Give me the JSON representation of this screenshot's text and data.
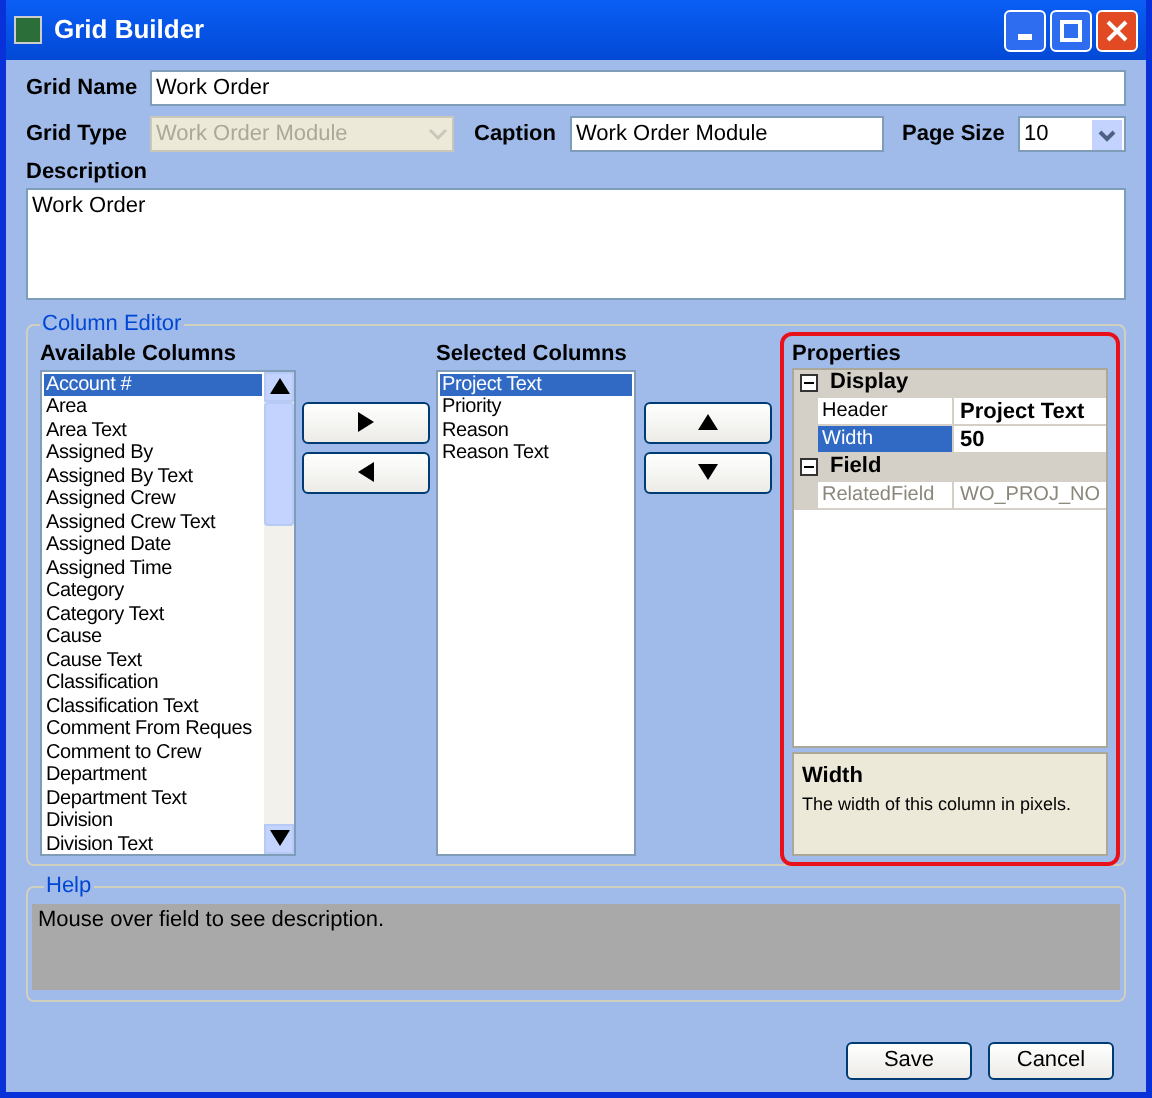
{
  "window": {
    "title": "Grid Builder"
  },
  "grid_name": {
    "label": "Grid Name",
    "value": "Work Order"
  },
  "grid_type": {
    "label": "Grid Type",
    "value": "Work Order Module",
    "disabled": true
  },
  "caption": {
    "label": "Caption",
    "value": "Work Order Module"
  },
  "page_size": {
    "label": "Page Size",
    "value": "10"
  },
  "description": {
    "label": "Description",
    "value": "Work Order"
  },
  "column_editor": {
    "title": "Column Editor",
    "available": {
      "label": "Available Columns",
      "items": [
        {
          "text": "Account #",
          "selected": true
        },
        {
          "text": "Area",
          "selected": false
        },
        {
          "text": "Area Text",
          "selected": false
        },
        {
          "text": "Assigned By",
          "selected": false
        },
        {
          "text": "Assigned By Text",
          "selected": false
        },
        {
          "text": "Assigned Crew",
          "selected": false
        },
        {
          "text": "Assigned Crew Text",
          "selected": false
        },
        {
          "text": "Assigned Date",
          "selected": false
        },
        {
          "text": "Assigned Time",
          "selected": false
        },
        {
          "text": "Category",
          "selected": false
        },
        {
          "text": "Category Text",
          "selected": false
        },
        {
          "text": "Cause",
          "selected": false
        },
        {
          "text": "Cause Text",
          "selected": false
        },
        {
          "text": "Classification",
          "selected": false
        },
        {
          "text": "Classification Text",
          "selected": false
        },
        {
          "text": "Comment From Reques",
          "selected": false
        },
        {
          "text": "Comment to Crew",
          "selected": false
        },
        {
          "text": "Department",
          "selected": false
        },
        {
          "text": "Department Text",
          "selected": false
        },
        {
          "text": "Division",
          "selected": false
        },
        {
          "text": "Division Text",
          "selected": false
        }
      ]
    },
    "selected": {
      "label": "Selected Columns",
      "items": [
        {
          "text": "Project Text",
          "selected": true
        },
        {
          "text": "Priority",
          "selected": false
        },
        {
          "text": "Reason",
          "selected": false
        },
        {
          "text": "Reason Text",
          "selected": false
        }
      ]
    },
    "properties": {
      "label": "Properties",
      "categories": [
        {
          "name": "Display",
          "expanded": true,
          "rows": [
            {
              "name": "Header",
              "value": "Project Text",
              "selected": false,
              "disabled": false
            },
            {
              "name": "Width",
              "value": "50",
              "selected": true,
              "disabled": false
            }
          ]
        },
        {
          "name": "Field",
          "expanded": true,
          "rows": [
            {
              "name": "RelatedField",
              "value": "WO_PROJ_NO",
              "selected": false,
              "disabled": true
            }
          ]
        }
      ],
      "description": {
        "title": "Width",
        "text": "The width of this column in pixels."
      }
    }
  },
  "help": {
    "title": "Help",
    "text": "Mouse over field to see description."
  },
  "buttons": [
    "Save",
    "Cancel"
  ]
}
